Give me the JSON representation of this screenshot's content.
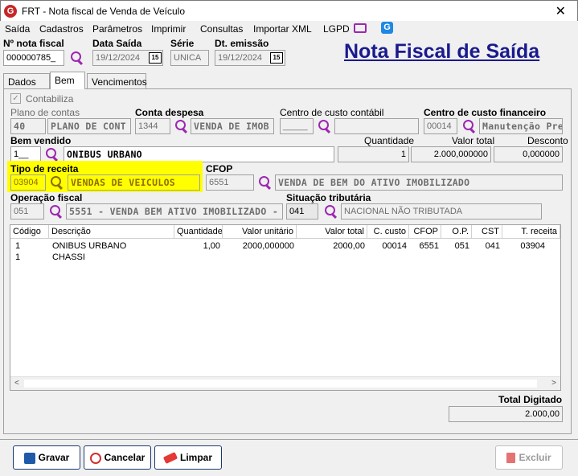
{
  "window": {
    "title": "FRT - Nota fiscal de Venda de Veículo"
  },
  "menu": [
    {
      "label": "Saída",
      "key": "S"
    },
    {
      "label": "Cadastros",
      "key": "C"
    },
    {
      "label": "Parâmetros",
      "key": "P"
    },
    {
      "label": "Imprimir",
      "key": "I"
    },
    {
      "label": "Consultas",
      "key": "o"
    },
    {
      "label": "Importar XML",
      "key": "m"
    },
    {
      "label": "LGPD",
      "key": "G"
    }
  ],
  "header": {
    "nota_label": "Nº nota fiscal",
    "nota_value": "000000785_",
    "data_saida_label": "Data Saída",
    "data_saida_value": "19/12/2024",
    "serie_label": "Série",
    "serie_value": "UNICA",
    "dt_emissao_label": "Dt. emissão",
    "dt_emissao_value": "19/12/2024",
    "cal_icon_text": "15",
    "page_title": "Nota Fiscal de Saída"
  },
  "tabs": [
    {
      "label": "Dados NF",
      "active": false
    },
    {
      "label": "Bem",
      "active": true
    },
    {
      "label": "Vencimentos",
      "active": false
    }
  ],
  "bem": {
    "contabiliza_label": "Contabiliza",
    "plano_label": "Plano de contas",
    "plano_code": "40",
    "plano_desc": "PLANO DE CONT",
    "conta_label": "Conta despesa",
    "conta_code": "1344",
    "conta_desc": "VENDA DE IMOB",
    "ccc_label": "Centro de custo contábil",
    "ccc_code": "_____",
    "ccc_desc": "",
    "ccf_label": "Centro de custo financeiro",
    "ccf_code": "00014",
    "ccf_desc": "Manutenção Prev",
    "bem_label": "Bem vendido",
    "bem_code": "1__",
    "bem_desc": "ONIBUS URBANO",
    "qtd_label": "Quantidade",
    "qtd_value": "1",
    "valor_label": "Valor total",
    "valor_value": "2.000,000000",
    "desconto_label": "Desconto",
    "desconto_value": "0,000000",
    "tipo_label": "Tipo de receita",
    "tipo_code": "03904",
    "tipo_desc": "VENDAS DE VEICULOS",
    "cfop_label": "CFOP",
    "cfop_code": "6551",
    "cfop_desc": "VENDA DE BEM DO ATIVO IMOBILIZADO",
    "op_label": "Operação fiscal",
    "op_code": "051",
    "op_desc": "5551 - VENDA BEM ATIVO IMOBILIZADO - SP",
    "sit_label": "Situação tributária",
    "sit_code": "041",
    "sit_desc": "NACIONAL NÃO TRIBUTADA"
  },
  "grid": {
    "columns": [
      "Código",
      "Descrição",
      "Quantidade",
      "Valor unitário",
      "Valor total",
      "C. custo",
      "CFOP",
      "O.P.",
      "CST",
      "T. receita"
    ],
    "rows": [
      [
        "1",
        "ONIBUS URBANO",
        "1,00",
        "2000,000000",
        "2000,00",
        "00014",
        "6551",
        "051",
        "041",
        "03904"
      ],
      [
        "1",
        "CHASSI",
        "",
        "",
        "",
        "",
        "",
        "",
        "",
        ""
      ]
    ]
  },
  "totals": {
    "label": "Total Digitado",
    "value": "2.000,00"
  },
  "buttons": {
    "gravar": "Gravar",
    "cancelar": "Cancelar",
    "limpar": "Limpar",
    "excluir": "Excluir"
  },
  "colors": {
    "accent_purple": "#9c27b0",
    "title_blue": "#1a1a8e",
    "highlight": "#ffff00"
  }
}
